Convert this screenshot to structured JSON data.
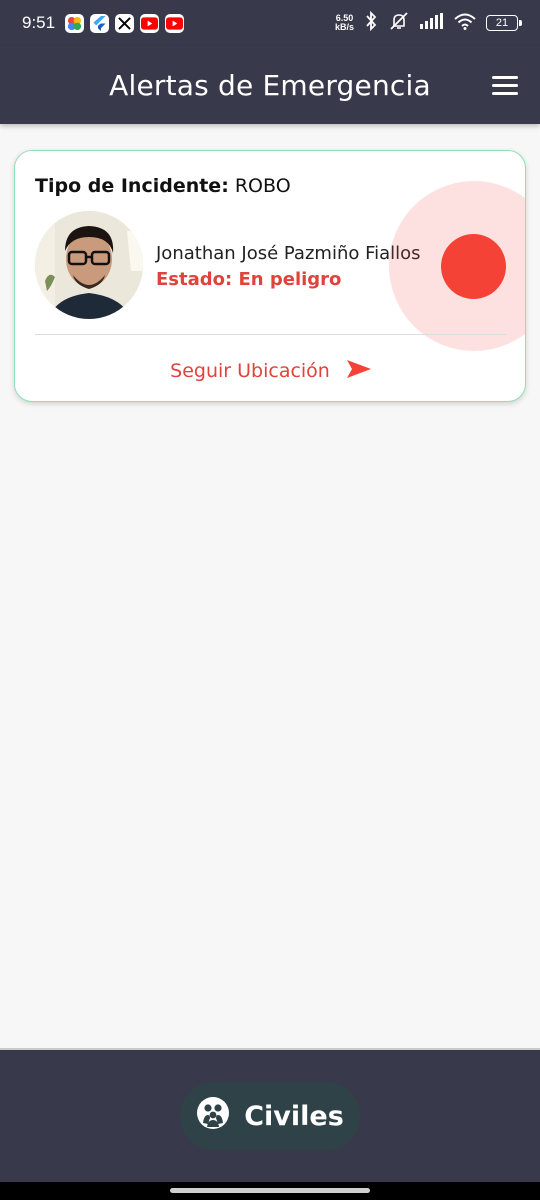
{
  "status_bar": {
    "time": "9:51",
    "net_speed_value": "6.50",
    "net_speed_unit": "kB/s",
    "battery": "21",
    "apps": [
      "photos-icon",
      "flutter-icon",
      "x-icon",
      "youtube-icon",
      "youtube-icon"
    ]
  },
  "app_bar": {
    "title": "Alertas de Emergencia",
    "menu_icon": "hamburger-menu-icon"
  },
  "alert_card": {
    "incident_label": "Tipo de Incidente:",
    "incident_value": "ROBO",
    "name": "Jonathan José Pazmiño Fiallos",
    "status": "Estado: En peligro",
    "follow_label": "Seguir Ubicación",
    "follow_icon": "send-arrow-icon",
    "accent_color": "#f44336",
    "border_color": "#8fe0b4"
  },
  "bottom_bar": {
    "button_label": "Civiles",
    "button_icon": "group-icon"
  },
  "colors": {
    "bar_background": "#383a4c",
    "button_background": "#2f4247",
    "alert_red": "#e0433c"
  }
}
